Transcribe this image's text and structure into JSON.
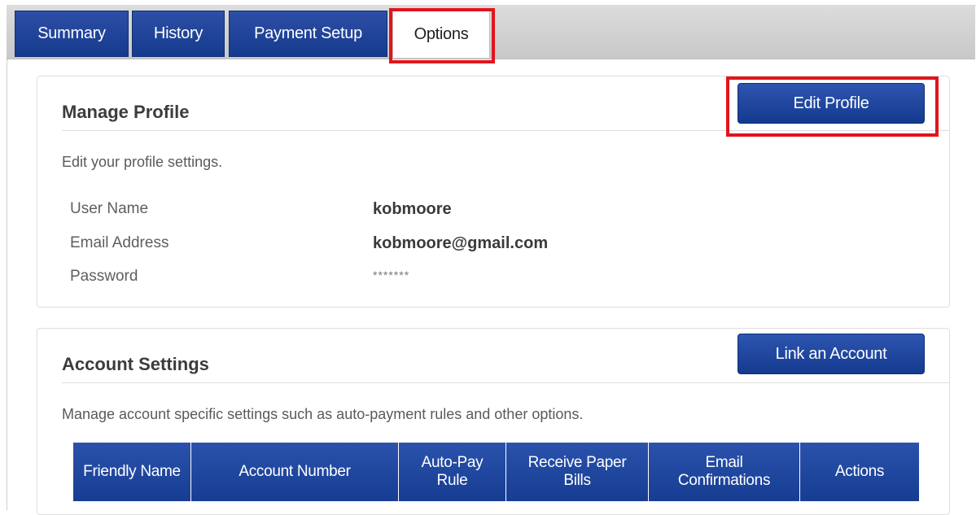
{
  "tabs": [
    {
      "label": "Summary",
      "active": false
    },
    {
      "label": "History",
      "active": false
    },
    {
      "label": "Payment Setup",
      "active": false
    },
    {
      "label": "Options",
      "active": true
    }
  ],
  "manage_profile": {
    "title": "Manage Profile",
    "button": "Edit Profile",
    "description": "Edit your profile settings.",
    "fields": [
      {
        "label": "User Name",
        "value": "kobmoore"
      },
      {
        "label": "Email Address",
        "value": "kobmoore@gmail.com"
      },
      {
        "label": "Password",
        "value": "*******"
      }
    ]
  },
  "account_settings": {
    "title": "Account Settings",
    "button": "Link an Account",
    "description": "Manage account specific settings such as auto-payment rules and other options.",
    "columns": [
      "Friendly Name",
      "Account Number",
      "Auto-Pay Rule",
      "Receive Paper Bills",
      "Email Confirmations",
      "Actions"
    ]
  },
  "colors": {
    "accent_blue": "#1a3f94",
    "highlight_red": "#e2141c"
  }
}
